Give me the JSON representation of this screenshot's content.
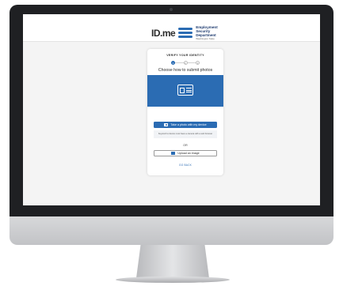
{
  "header": {
    "idme_logo": "ID.me",
    "department_lines": [
      "Employment",
      "Security",
      "Department"
    ],
    "department_tagline": "Washington State"
  },
  "card": {
    "heading": "VERIFY YOUR IDENTITY",
    "steps": [
      "1",
      "2",
      "3"
    ],
    "active_step": 1,
    "title": "Choose how to submit photos",
    "primary_button": "Take a photo with my device",
    "note": "Keyword to device must have a camera with a web browser",
    "or_label": "OR",
    "secondary_button": "Upload an image",
    "back_link": "GO BACK"
  },
  "colors": {
    "accent": "#2b6cb3",
    "bezel": "#1f2023"
  },
  "icons": {
    "hero": "id-card-icon",
    "primary_button": "camera-icon",
    "secondary_button": "image-icon"
  }
}
